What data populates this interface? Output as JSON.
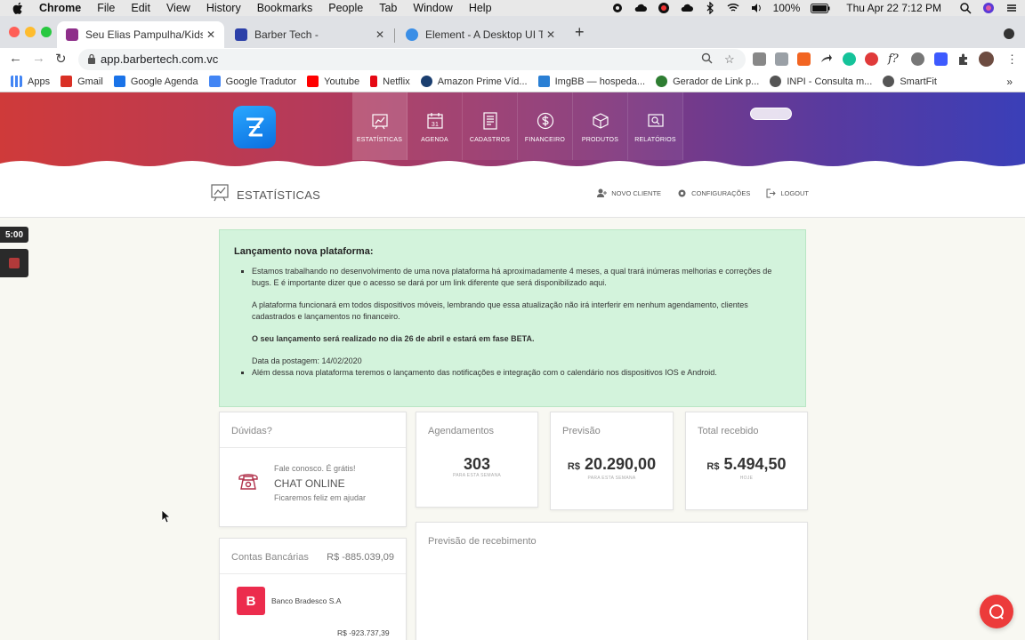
{
  "macos": {
    "app_name": "Chrome",
    "menus": [
      "File",
      "Edit",
      "View",
      "History",
      "Bookmarks",
      "People",
      "Tab",
      "Window",
      "Help"
    ],
    "battery": "100%",
    "clock": "Thu Apr 22  7:12 PM"
  },
  "browser": {
    "tabs": [
      {
        "title": "Seu Elias Pampulha/Kids - Bar",
        "active": true,
        "color": "#8e2f8a"
      },
      {
        "title": "Barber Tech -",
        "active": false,
        "color": "#2b3fa8"
      },
      {
        "title": "Element - A Desktop UI Toolkit",
        "active": false,
        "color": "#3a8ee6"
      }
    ],
    "url": "app.barbertech.com.vc",
    "bookmarks": [
      {
        "label": "Apps",
        "color": "#4285f4"
      },
      {
        "label": "Gmail",
        "color": "#d93025"
      },
      {
        "label": "Google Agenda",
        "color": "#1a73e8"
      },
      {
        "label": "Google Tradutor",
        "color": "#4285f4"
      },
      {
        "label": "Youtube",
        "color": "#ff0000"
      },
      {
        "label": "Netflix",
        "color": "#e50914"
      },
      {
        "label": "Amazon Prime Víd...",
        "color": "#1a3e6f"
      },
      {
        "label": "ImgBB — hospeda...",
        "color": "#2a7fd4"
      },
      {
        "label": "Gerador de Link p...",
        "color": "#2e7d32"
      },
      {
        "label": "INPI - Consulta m...",
        "color": "#555555"
      },
      {
        "label": "SmartFit",
        "color": "#555555"
      }
    ]
  },
  "app": {
    "nav": [
      {
        "label": "ESTATÍSTICAS",
        "icon": "chart-icon",
        "active": true
      },
      {
        "label": "AGENDA",
        "icon": "calendar-icon",
        "active": false
      },
      {
        "label": "CADASTROS",
        "icon": "form-icon",
        "active": false
      },
      {
        "label": "FINANCEIRO",
        "icon": "dollar-icon",
        "active": false
      },
      {
        "label": "PRODUTOS",
        "icon": "box-icon",
        "active": false
      },
      {
        "label": "RELATÓRIOS",
        "icon": "report-icon",
        "active": false
      }
    ],
    "calendar_day": "31",
    "page_title": "ESTATÍSTICAS",
    "actions": {
      "new_client": "NOVO CLIENTE",
      "settings": "CONFIGURAÇÕES",
      "logout": "LOGOUT"
    }
  },
  "timer": "5:00",
  "announcement": {
    "title": "Lançamento nova plataforma:",
    "p1": "Estamos trabalhando no desenvolvimento de uma nova plataforma há aproximadamente 4 meses, a qual trará inúmeras melhorias e correções de bugs. E é importante dizer que o acesso se dará por um link diferente que será disponibilizado aqui.",
    "p2": "A plataforma funcionará em todos dispositivos móveis, lembrando que essa atualização não irá interferir em nenhum agendamento, clientes cadastrados e lançamentos no financeiro.",
    "p3": "O seu lançamento será realizado no dia 26 de abril e estará em fase BETA.",
    "p4": "Data da postagem: 14/02/2020",
    "p5": "Além dessa nova plataforma teremos o lançamento das notificações e integração com o calendário nos dispositivos IOS e Android."
  },
  "cards": {
    "doubts": {
      "title": "Dúvidas?",
      "line1": "Fale conosco. É grátis!",
      "line2": "CHAT ONLINE",
      "line3": "Ficaremos feliz em ajudar"
    },
    "agendamentos": {
      "title": "Agendamentos",
      "value": "303",
      "sub": "PARA ESTA SEMANA"
    },
    "previsao": {
      "title": "Previsão",
      "currency": "R$",
      "value": "20.290,00",
      "sub": "PARA ESTA SEMANA"
    },
    "total": {
      "title": "Total recebido",
      "currency": "R$",
      "value": "5.494,50",
      "sub": "HOJE"
    },
    "bank_accounts": {
      "title": "Contas Bancárias",
      "total": "R$ -885.039,09",
      "bank_letter": "B",
      "bank_name": "Banco Bradesco S.A",
      "bank_value": "R$ -923.737,39"
    },
    "forecast_receipt": {
      "title": "Previsão de recebimento"
    }
  }
}
